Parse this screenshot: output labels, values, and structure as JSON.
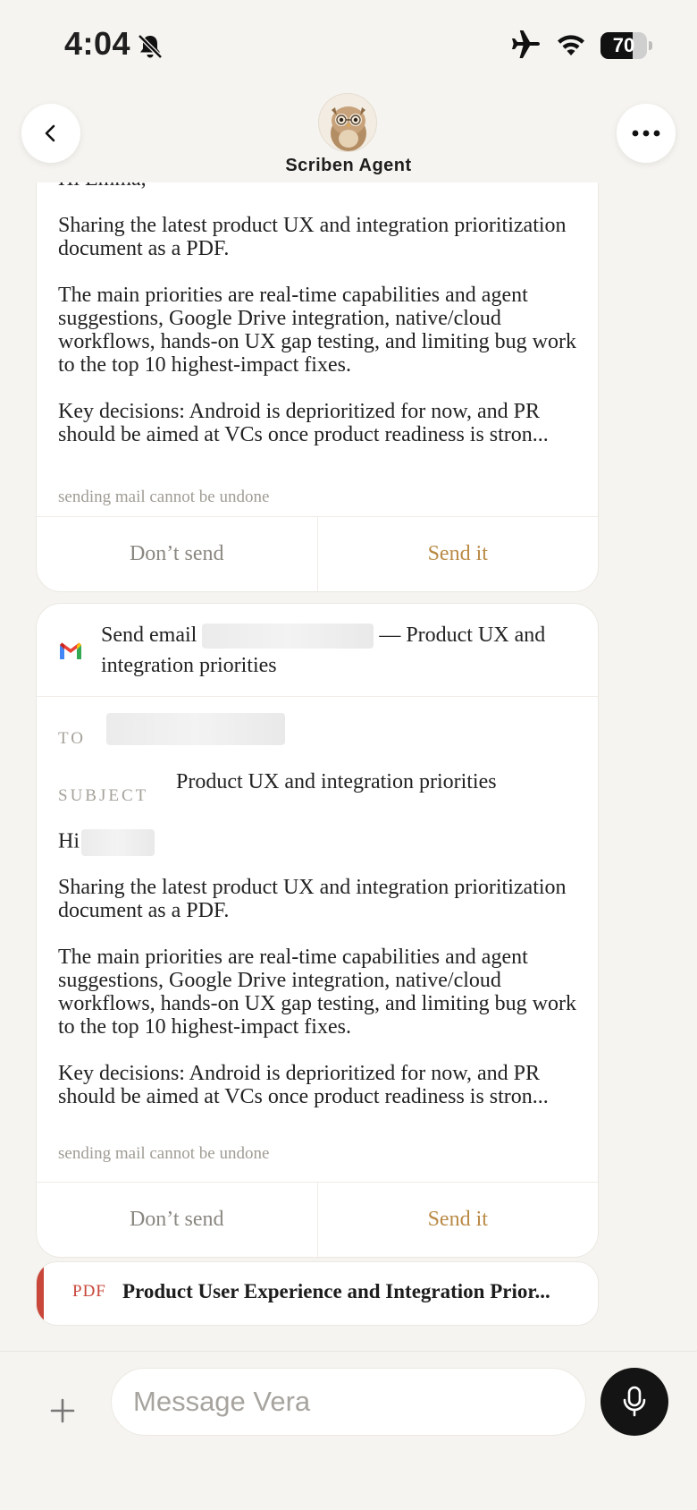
{
  "status_bar": {
    "time": "4:04",
    "battery": "70",
    "battery_level_percent": 70
  },
  "header": {
    "agent_name": "Scriben Agent"
  },
  "card1": {
    "greeting_partial": "Hi Emma,",
    "paragraphs": [
      "Sharing the latest product UX and integration prioritization document as a PDF.",
      "The main priorities are real-time capabilities and agent suggestions, Google Drive integration, native/cloud workflows, hands-on UX gap testing, and limiting bug work to the top 10 highest-impact fixes.",
      "Key decisions: Android is deprioritized for now, and PR should be aimed at VCs once product readiness is stron..."
    ],
    "warning": "sending mail cannot be undone",
    "dont_send_label": "Don’t send",
    "send_label": "Send it"
  },
  "card2": {
    "title_prefix": "Send email",
    "title_suffix": "— Product UX and integration priorities",
    "to_label": "TO",
    "subject_label": "SUBJECT",
    "subject": "Product UX and integration priorities",
    "greeting": "Hi",
    "paragraphs": [
      "Sharing the latest product UX and integration prioritization document as a PDF.",
      "The main priorities are real-time capabilities and agent suggestions, Google Drive integration, native/cloud workflows, hands-on UX gap testing, and limiting bug work to the top 10 highest-impact fixes.",
      "Key decisions: Android is deprioritized for now, and PR should be aimed at VCs once product readiness is stron..."
    ],
    "warning": "sending mail cannot be undone",
    "dont_send_label": "Don’t send",
    "send_label": "Send it"
  },
  "attachment": {
    "type_label": "PDF",
    "title": "Product User Experience and Integration Prior..."
  },
  "composer": {
    "placeholder": "Message Vera"
  },
  "icons": {
    "back": "chevron-left-icon",
    "more": "more-horizontal-icon",
    "mic": "microphone-icon",
    "add": "plus-icon",
    "gmail": "gmail-icon"
  }
}
